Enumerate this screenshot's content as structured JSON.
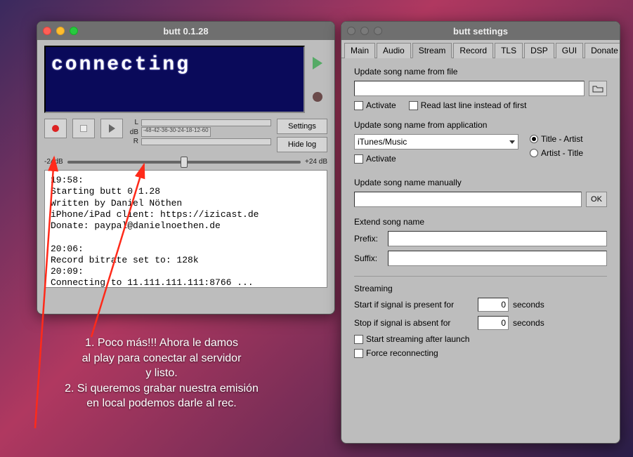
{
  "main_window": {
    "title": "butt 0.1.28",
    "lcd_text": "connecting",
    "db_scale": [
      "-48",
      "-42",
      "-36",
      "-30",
      "-24",
      "-18",
      "-12",
      "-6",
      "0"
    ],
    "db_label": "dB",
    "meter_l": "L",
    "meter_r": "R",
    "settings_btn": "Settings",
    "hidelog_btn": "Hide log",
    "slider_min": "-24dB",
    "slider_max": "+24 dB",
    "log": "19:58:\nStarting butt 0.1.28\nWritten by Daniel Nöthen\niPhone/iPad client: https://izicast.de\nDonate: paypal@danielnoethen.de\n\n20:06:\nRecord bitrate set to: 128k\n20:09:\nConnecting to 11.111.111.111:8766 ..."
  },
  "settings_window": {
    "title": "butt settings",
    "tabs": {
      "main": "Main",
      "audio": "Audio",
      "stream": "Stream",
      "record": "Record",
      "tls": "TLS",
      "dsp": "DSP",
      "gui": "GUI",
      "donate": "Donate"
    },
    "update_file_label": "Update song name from file",
    "activate_label": "Activate",
    "read_last_label": "Read last line instead of first",
    "update_app_label": "Update song name from application",
    "app_select_value": "iTunes/Music",
    "title_artist_label": "Title - Artist",
    "artist_title_label": "Artist - Title",
    "update_manual_label": "Update song name manually",
    "ok_label": "OK",
    "extend_label": "Extend song name",
    "prefix_label": "Prefix:",
    "suffix_label": "Suffix:",
    "streaming_label": "Streaming",
    "start_if_label_a": "Start if signal is present for",
    "start_if_label_b": "seconds",
    "stop_if_label_a": "Stop if signal is absent for",
    "stop_if_label_b": "seconds",
    "start_if_value": "0",
    "stop_if_value": "0",
    "start_after_launch_label": "Start streaming after launch",
    "force_reconn_label": "Force reconnecting"
  },
  "annotations": {
    "line1": "1. Poco más!!! Ahora le damos",
    "line2": "al play para conectar al servidor",
    "line3": "y listo.",
    "line4": "2. Si queremos grabar nuestra emisión",
    "line5": "en local podemos darle al rec."
  }
}
